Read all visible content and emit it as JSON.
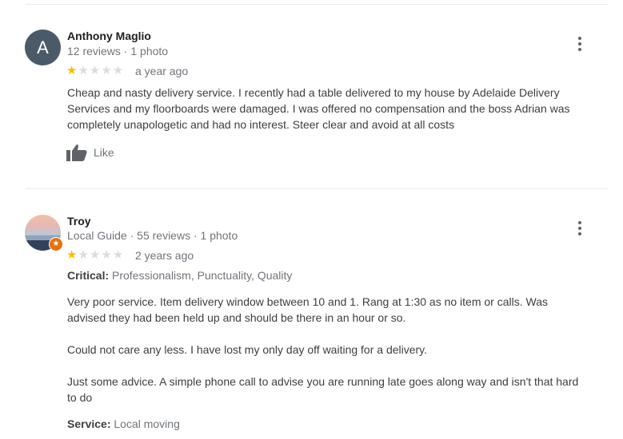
{
  "reviews": [
    {
      "author": "Anthony Maglio",
      "avatar_letter": "A",
      "meta": "12 reviews · 1 photo",
      "rating": 1,
      "date": "a year ago",
      "text_lines": [
        "Cheap and nasty delivery service. I recently had a table delivered to my house by Adelaide Delivery",
        "Services and my floorboards were damaged. I was offered no compensation and the boss Adrian was",
        "completely unapologetic and had no interest. Steer clear and avoid  at all costs"
      ],
      "like_label": "Like",
      "more_icon": "more-vert-icon"
    },
    {
      "author": "Troy",
      "meta": "Local Guide · 55 reviews · 1 photo",
      "rating": 1,
      "date": "2 years ago",
      "critical_label": "Critical:",
      "critical_value": "Professionalism, Punctuality, Quality",
      "text_lines": [
        "Very poor service. Item delivery window between 10 and 1. Rang at 1:30 as no item or calls. Was",
        "advised they had been held up and should be there in an hour or so.",
        "",
        "Could not care any less. I have lost my only day off waiting for a delivery.",
        "",
        "Just some advice. A simple phone call to advise you are running late goes along way and isn't that hard",
        "to do"
      ],
      "service_label": "Service:",
      "service_value": "Local moving",
      "more_icon": "more-vert-icon"
    }
  ],
  "colors": {
    "star_filled": "#fbbc04",
    "star_empty": "#dadce0",
    "local_guide_badge": "#e8710a"
  }
}
